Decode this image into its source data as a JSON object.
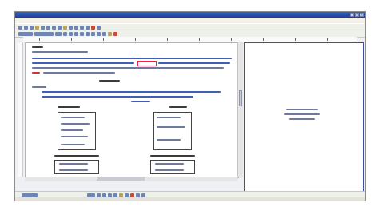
{
  "window": {
    "title": ""
  },
  "menu": {
    "items": [
      "",
      "",
      "",
      "",
      "",
      "",
      "",
      "",
      ""
    ]
  },
  "preview": {
    "caption": ""
  },
  "document": {
    "heading": "",
    "section_title": ""
  },
  "tables": [
    {
      "header": "",
      "rows": [
        "",
        "",
        "",
        "",
        ""
      ]
    },
    {
      "header": "",
      "rows": [
        "",
        "",
        "",
        "",
        ""
      ]
    }
  ],
  "colors": {
    "title_bar": "#1d3f98",
    "accent_blue": "#3e5fb5",
    "highlight": "#e22244"
  }
}
